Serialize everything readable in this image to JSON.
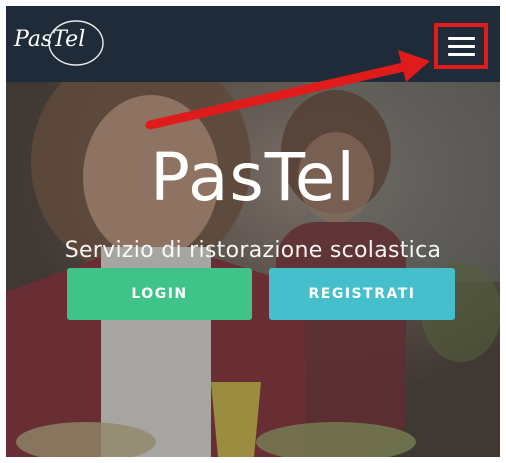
{
  "navbar": {
    "logo_text": "PasTel",
    "menu_icon": "hamburger-menu-icon"
  },
  "hero": {
    "title": "PasTel",
    "subtitle": "Servizio di ristorazione scolastica",
    "login_label": "LOGIN",
    "register_label": "REGISTRATI"
  },
  "annotation": {
    "highlight_color": "#e01b1b",
    "arrow_color": "#e01b1b",
    "target": "hamburger-menu-button"
  },
  "colors": {
    "navbar_bg": "#1f2b38",
    "login_bg": "#3fc389",
    "register_bg": "#45bfcb"
  }
}
